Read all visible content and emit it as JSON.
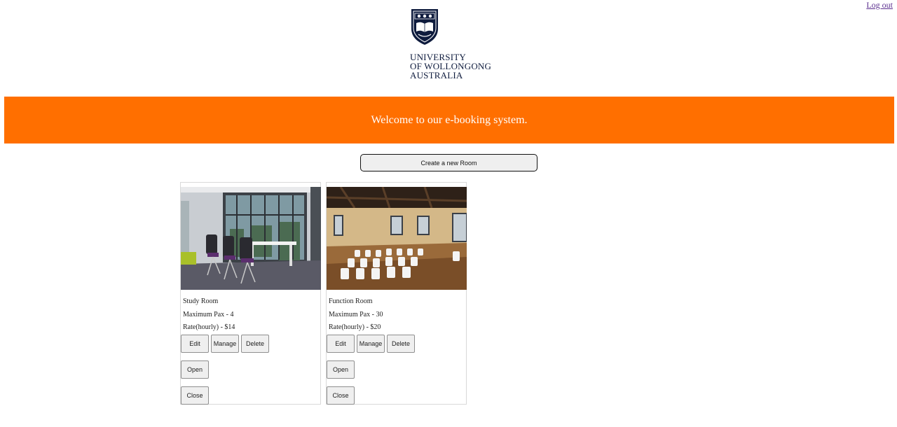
{
  "header": {
    "logout_label": "Log out",
    "logo": {
      "line1": "UNIVERSITY",
      "line2": "OF WOLLONGONG",
      "line3": "AUSTRALIA",
      "crest_icon": "university-crest-icon"
    }
  },
  "banner": {
    "text": "Welcome to our e-booking system."
  },
  "actions": {
    "create_room_label": "Create a new Room"
  },
  "rooms": [
    {
      "name": "Study Room",
      "max_pax": "Maximum Pax - 4",
      "rate": "Rate(hourly) - $14",
      "buttons": {
        "edit": "Edit",
        "manage": "Manage",
        "delete": "Delete",
        "open": "Open",
        "close": "Close"
      }
    },
    {
      "name": "Function Room",
      "max_pax": "Maximum Pax - 30",
      "rate": "Rate(hourly) - $20",
      "buttons": {
        "edit": "Edit",
        "manage": "Manage",
        "delete": "Delete",
        "open": "Open",
        "close": "Close"
      }
    }
  ],
  "colors": {
    "banner_bg": "#ff6f00",
    "banner_text": "#ffffff",
    "logo_navy": "#0e1b3d",
    "link_purple": "#5b2f8f"
  }
}
